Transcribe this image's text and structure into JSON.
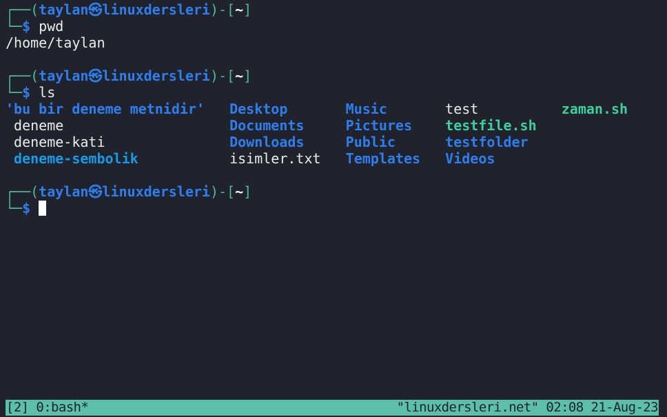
{
  "colors": {
    "background": "#20232c",
    "prompt_frame": "#4fb89e",
    "prompt_user": "#2f7ef0",
    "directory": "#2f7ef0",
    "executable": "#3fcf9e",
    "symlink": "#199ae6",
    "status_bar": "#5cbfa9"
  },
  "prompt": {
    "top_left": "┌──(",
    "user_host": "taylan㉿linuxdersleri",
    "mid": ")-[",
    "cwd": "~",
    "close": "]",
    "bottom_left": "└─",
    "symbol": "$"
  },
  "commands": [
    {
      "command": " pwd",
      "output": "/home/taylan"
    },
    {
      "command": " ls"
    }
  ],
  "ls_rows": [
    [
      {
        "name": "'bu bir deneme metnidir'",
        "type": "dir"
      },
      {
        "name": "Desktop",
        "type": "dir"
      },
      {
        "name": "Music",
        "type": "dir"
      },
      {
        "name": "test",
        "type": "file"
      },
      {
        "name": "zaman.sh",
        "type": "exec"
      }
    ],
    [
      {
        "name": "deneme",
        "type": "file"
      },
      {
        "name": "Documents",
        "type": "dir"
      },
      {
        "name": "Pictures",
        "type": "dir"
      },
      {
        "name": "testfile.sh",
        "type": "exec"
      }
    ],
    [
      {
        "name": "deneme-kati",
        "type": "file"
      },
      {
        "name": "Downloads",
        "type": "dir"
      },
      {
        "name": "Public",
        "type": "dir"
      },
      {
        "name": "testfolder",
        "type": "dir"
      }
    ],
    [
      {
        "name": "deneme-sembolik",
        "type": "link"
      },
      {
        "name": "isimler.txt",
        "type": "file"
      },
      {
        "name": "Templates",
        "type": "dir"
      },
      {
        "name": "Videos",
        "type": "dir"
      }
    ]
  ],
  "status_bar": {
    "left": "[2] 0:bash*",
    "right": "\"linuxdersleri.net\" 02:08 21-Aug-23"
  }
}
